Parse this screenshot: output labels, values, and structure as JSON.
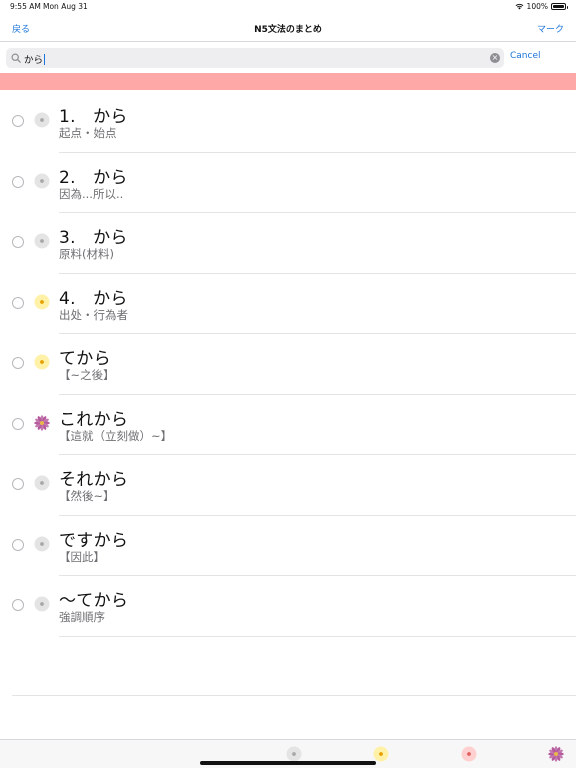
{
  "status": {
    "time": "9:55 AM",
    "date": "Mon Aug 31",
    "battery": "100%"
  },
  "nav": {
    "back": "戻る",
    "title": "N5文法のまとめ",
    "mark": "マーク"
  },
  "search": {
    "value": "から",
    "cancel": "Cancel"
  },
  "items": [
    {
      "title": "1.　から",
      "sub": "起点・始点",
      "badge": "gray"
    },
    {
      "title": "2.　から",
      "sub": "因為...所以..",
      "badge": "gray"
    },
    {
      "title": "3.　から",
      "sub": "原料(材料)",
      "badge": "gray"
    },
    {
      "title": "4.　から",
      "sub": "出处・行為者",
      "badge": "yellow"
    },
    {
      "title": "てから",
      "sub": "【~之後】",
      "badge": "yellow"
    },
    {
      "title": "これから",
      "sub": "【這就（立刻做）~】",
      "badge": "purple"
    },
    {
      "title": "それから",
      "sub": "【然後~】",
      "badge": "gray"
    },
    {
      "title": "ですから",
      "sub": "【因此】",
      "badge": "gray"
    },
    {
      "title": "～てから",
      "sub": "強調順序",
      "badge": "gray"
    }
  ],
  "tabs": [
    {
      "icon": "gray-flower-icon",
      "color": "#d8d8d8"
    },
    {
      "icon": "yellow-flower-icon",
      "color": "#fff1a8"
    },
    {
      "icon": "pink-flower-icon",
      "color": "#ffc8c8"
    },
    {
      "icon": "purple-flower-icon",
      "color": "#c47ab0"
    }
  ],
  "colors": {
    "accent": "#1a73d9",
    "band": "#ffa8a8"
  }
}
